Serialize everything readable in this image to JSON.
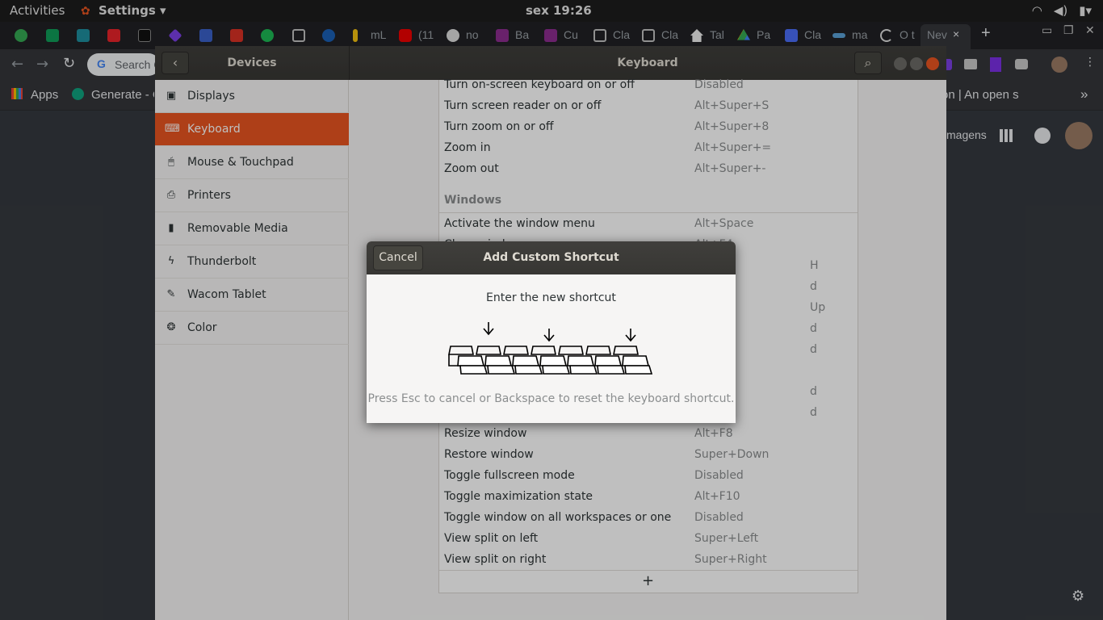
{
  "topbar": {
    "activities": "Activities",
    "app_menu": "Settings ▾",
    "clock": "sex 19:26"
  },
  "chrome": {
    "tabs": [
      "mL",
      "(11",
      "no",
      "Ba",
      "Cu",
      "Cla",
      "Cla",
      "Tal",
      "Pa",
      "Cla",
      "ma",
      "O t",
      "Nev"
    ],
    "new_tab": "+",
    "omnibox_placeholder": "Search G",
    "bookmarks": {
      "apps": "Apps",
      "generate": "Generate - C",
      "right_text": "on | An open s",
      "more": "»"
    },
    "page_text_right": "magens"
  },
  "settings": {
    "left_title": "Devices",
    "right_title": "Keyboard",
    "sidebar": [
      {
        "label": "Displays",
        "icon": "display-icon"
      },
      {
        "label": "Keyboard",
        "icon": "keyboard-icon"
      },
      {
        "label": "Mouse & Touchpad",
        "icon": "mouse-icon"
      },
      {
        "label": "Printers",
        "icon": "printer-icon"
      },
      {
        "label": "Removable Media",
        "icon": "usb-icon"
      },
      {
        "label": "Thunderbolt",
        "icon": "thunderbolt-icon"
      },
      {
        "label": "Wacom Tablet",
        "icon": "tablet-icon"
      },
      {
        "label": "Color",
        "icon": "color-icon"
      }
    ],
    "rows_top": [
      {
        "name": "Turn on-screen keyboard on or off",
        "key": "Disabled"
      },
      {
        "name": "Turn screen reader on or off",
        "key": "Alt+Super+S"
      },
      {
        "name": "Turn zoom on or off",
        "key": "Alt+Super+8"
      },
      {
        "name": "Zoom in",
        "key": "Alt+Super+="
      },
      {
        "name": "Zoom out",
        "key": "Alt+Super+-"
      }
    ],
    "section_windows": "Windows",
    "rows_windows_top": [
      {
        "name": "Activate the window menu",
        "key": "Alt+Space"
      },
      {
        "name": "Close window",
        "key": "Alt+F4"
      }
    ],
    "partial_keys": [
      "H",
      "d",
      "Up",
      "d",
      "d",
      "d",
      "d"
    ],
    "rows_windows_bottom": [
      {
        "name": "Resize window",
        "key": "Alt+F8"
      },
      {
        "name": "Restore window",
        "key": "Super+Down"
      },
      {
        "name": "Toggle fullscreen mode",
        "key": "Disabled"
      },
      {
        "name": "Toggle maximization state",
        "key": "Alt+F10"
      },
      {
        "name": "Toggle window on all workspaces or one",
        "key": "Disabled"
      },
      {
        "name": "View split on left",
        "key": "Super+Left"
      },
      {
        "name": "View split on right",
        "key": "Super+Right"
      }
    ],
    "add_button": "+"
  },
  "dialog": {
    "cancel": "Cancel",
    "title": "Add Custom Shortcut",
    "prompt": "Enter the new shortcut",
    "hint": "Press Esc to cancel or Backspace to reset the keyboard shortcut."
  }
}
